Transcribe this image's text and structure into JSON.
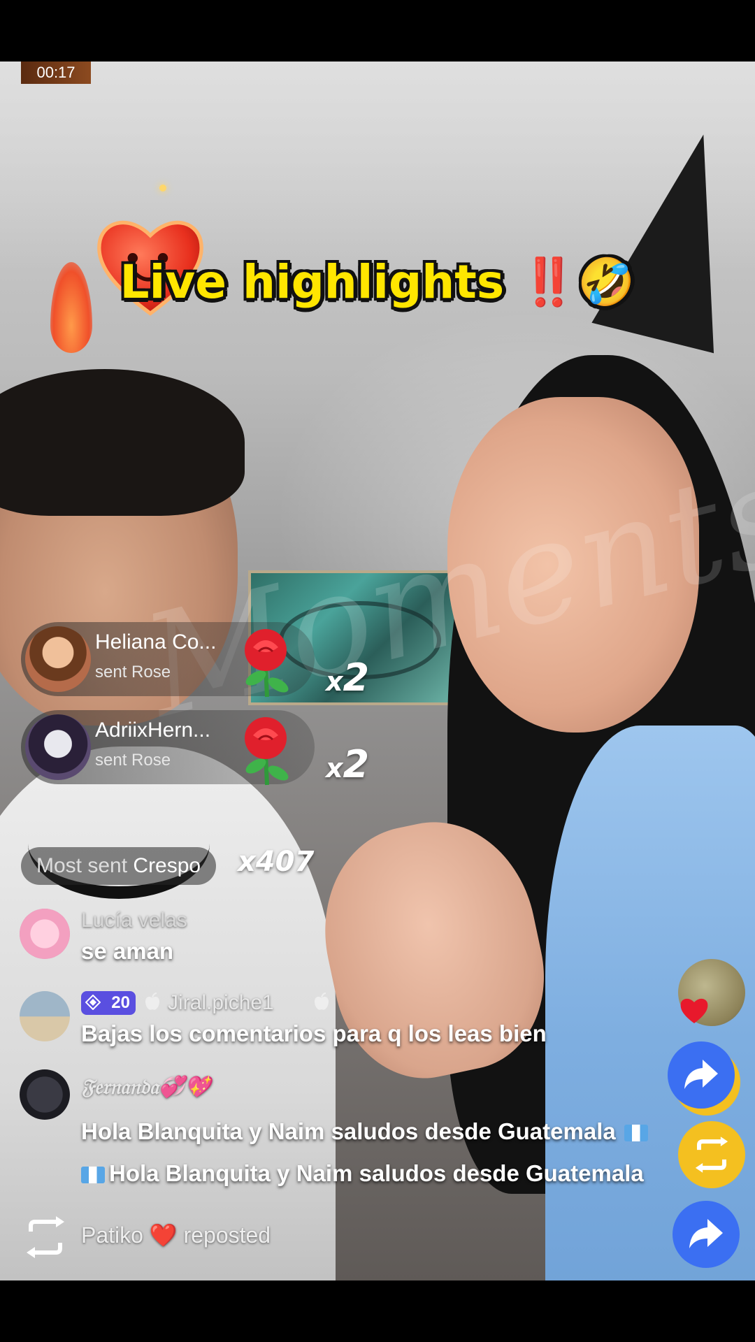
{
  "video": {
    "timer": "00:17",
    "title_main": "Live highlights",
    "title_bang": "‼️",
    "title_emoji": "🤣",
    "watermark": "Moments"
  },
  "gifts": [
    {
      "user": "Heliana Co...",
      "action": "sent Rose",
      "multiplier_x": "x",
      "multiplier_n": "2"
    },
    {
      "user": "AdriixHern...",
      "action": "sent Rose",
      "multiplier_x": "x",
      "multiplier_n": "2"
    }
  ],
  "most_sent": {
    "label": "Most sent",
    "gift": "Crespo",
    "count": "x407"
  },
  "comments": [
    {
      "user": "Lucía velas",
      "text": "se aman"
    },
    {
      "badge_level": "20",
      "user": "Jiral.piche1",
      "text": "Bajas los comentarios para q los leas bien"
    },
    {
      "user": "𝔉𝔢𝔯𝔫𝔞𝔫𝔡𝔞",
      "user_emoji": "💞💖",
      "text_line1": "Hola Blanquita y Naim saludos desde Guatemala",
      "text_line2": "Hola Blanquita y Naim saludos desde Guatemala"
    }
  ],
  "repost": {
    "user": "Patiko",
    "heart": "❤️",
    "action": "reposted"
  },
  "colors": {
    "title_yellow": "#ffe600",
    "badge_purple": "#5a4fe0",
    "share_blue": "#3b6ff2",
    "gold": "#f4c020"
  },
  "icons": [
    "rose-icon",
    "share-icon",
    "repost-icon",
    "heart-icon",
    "gem-icon",
    "apple-icon",
    "flag-guatemala-icon"
  ]
}
